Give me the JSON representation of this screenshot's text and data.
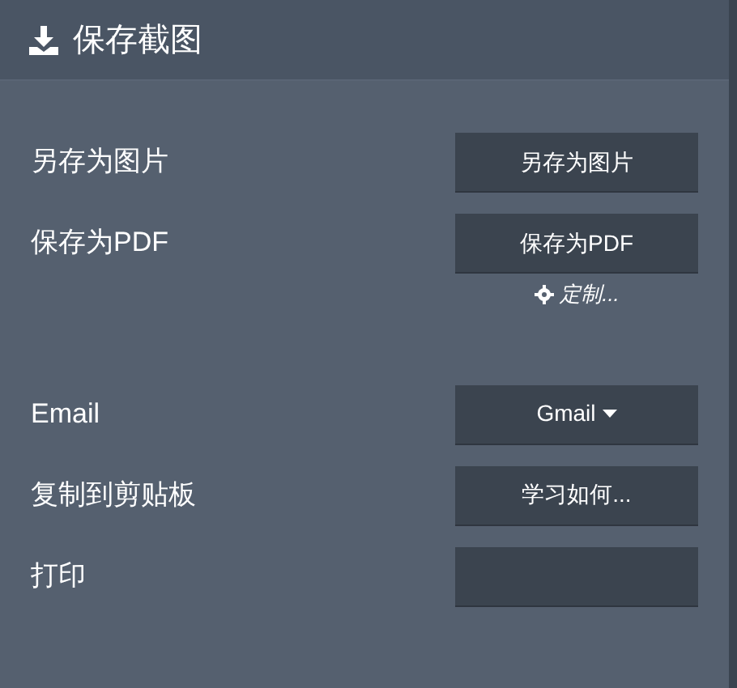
{
  "header": {
    "title": "保存截图"
  },
  "rows": [
    {
      "label": "另存为图片",
      "control": {
        "kind": "button",
        "text": "另存为图片"
      }
    },
    {
      "label": "保存为PDF",
      "control": {
        "kind": "button",
        "text": "保存为PDF"
      },
      "link": "定制..."
    },
    {
      "label": "Email",
      "control": {
        "kind": "dropdown",
        "text": "Gmail"
      }
    },
    {
      "label": "复制到剪贴板",
      "control": {
        "kind": "button",
        "text": "学习如何..."
      }
    },
    {
      "label": "打印",
      "control": {
        "kind": "button"
      }
    }
  ]
}
